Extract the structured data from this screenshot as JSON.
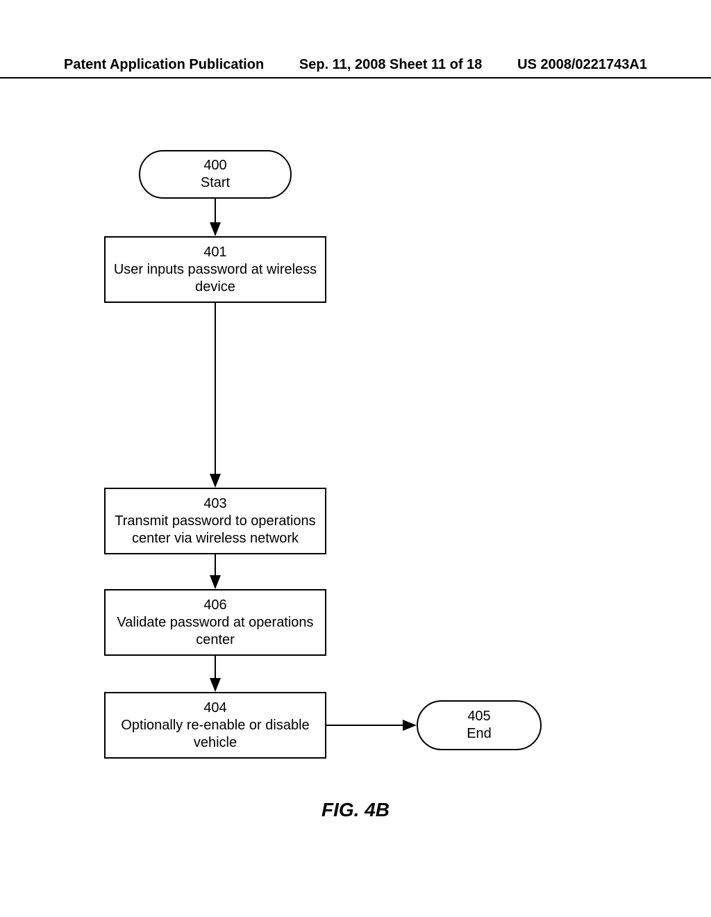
{
  "header": {
    "left": "Patent Application Publication",
    "center": "Sep. 11, 2008  Sheet 11 of 18",
    "right": "US 2008/0221743A1"
  },
  "nodes": {
    "start": {
      "num": "400",
      "label": "Start"
    },
    "step401": {
      "num": "401",
      "label": "User inputs password at wireless device"
    },
    "step403": {
      "num": "403",
      "label": "Transmit password to operations center via wireless network"
    },
    "step406": {
      "num": "406",
      "label": "Validate password at operations center"
    },
    "step404": {
      "num": "404",
      "label": "Optionally re-enable or disable vehicle"
    },
    "end": {
      "num": "405",
      "label": "End"
    }
  },
  "figure_label": "FIG. 4B"
}
